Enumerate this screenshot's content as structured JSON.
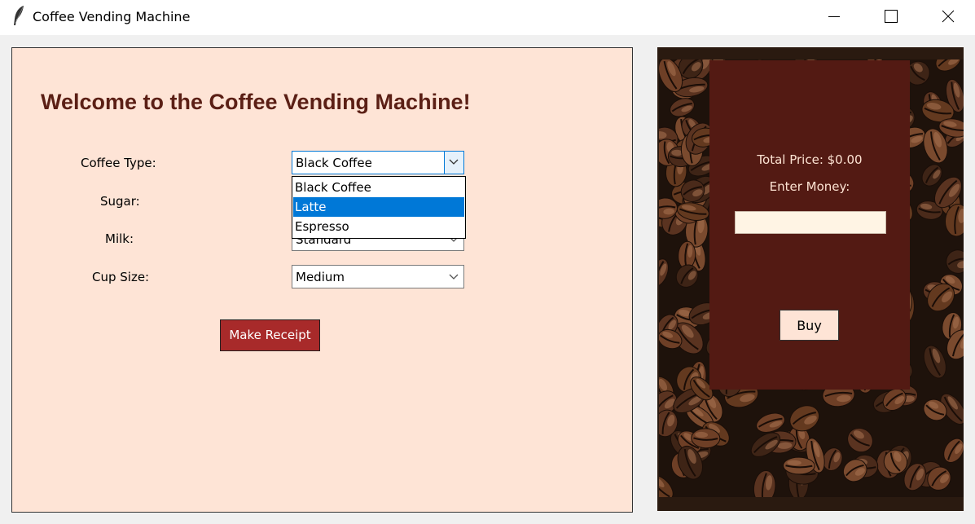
{
  "window": {
    "title": "Coffee Vending Machine",
    "icons": {
      "app": "feather-icon",
      "minimize": "minimize-icon",
      "maximize": "maximize-icon",
      "close": "close-icon"
    }
  },
  "form": {
    "welcome": "Welcome to the Coffee Vending Machine!",
    "coffee_type": {
      "label": "Coffee Type:",
      "value": "Black Coffee",
      "options": [
        "Black Coffee",
        "Latte",
        "Espresso"
      ],
      "highlighted_option": "Latte"
    },
    "sugar": {
      "label": "Sugar:"
    },
    "milk": {
      "label": "Milk:",
      "value": "Standard"
    },
    "cup_size": {
      "label": "Cup Size:",
      "value": "Medium"
    },
    "make_receipt": "Make Receipt"
  },
  "payment": {
    "total_price": "Total Price: $0.00",
    "enter_money": "Enter Money:",
    "money_value": "",
    "buy": "Buy"
  },
  "colors": {
    "form_bg": "#fee4d6",
    "welcome_text": "#5b1f15",
    "make_receipt_bg": "#a82a2a",
    "card_bg": "#531a13",
    "card_text": "#fde3d3",
    "money_input_bg": "#fff4e4",
    "selection": "#0078d7"
  },
  "background_image": "coffee-beans"
}
